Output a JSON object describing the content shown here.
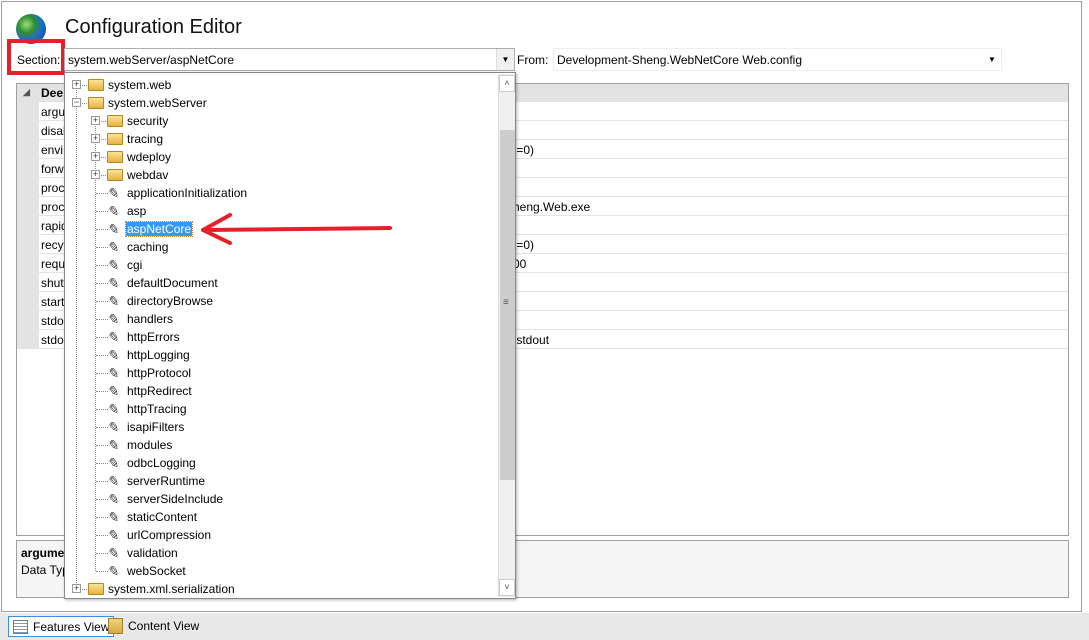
{
  "header": {
    "title": "Configuration Editor",
    "icon": "globe-icon"
  },
  "section": {
    "label": "Section:",
    "value": "system.webServer/aspNetCore"
  },
  "from": {
    "label": "From:",
    "value": "Development-Sheng.WebNetCore Web.config"
  },
  "grid": {
    "header": "Dee",
    "rows": [
      {
        "name": "argu",
        "value": ""
      },
      {
        "name": "disal",
        "value": ""
      },
      {
        "name": "envi",
        "value": "t=0)"
      },
      {
        "name": "forw",
        "value": ""
      },
      {
        "name": "proc",
        "value": ""
      },
      {
        "name": "proc",
        "value": "heng.Web.exe"
      },
      {
        "name": "rapid",
        "value": ""
      },
      {
        "name": "recy",
        "value": "t=0)"
      },
      {
        "name": "requ",
        "value": "00"
      },
      {
        "name": "shut",
        "value": ""
      },
      {
        "name": "start",
        "value": ""
      },
      {
        "name": "stdo",
        "value": ""
      },
      {
        "name": "stdo",
        "value": ".stdout"
      }
    ]
  },
  "description": {
    "name": "argume",
    "datatype": "Data Typ"
  },
  "tree": [
    {
      "label": "system.web",
      "level": 0,
      "type": "folder",
      "expander": "+"
    },
    {
      "label": "system.webServer",
      "level": 0,
      "type": "folder",
      "expander": "−"
    },
    {
      "label": "security",
      "level": 1,
      "type": "folder",
      "expander": "+"
    },
    {
      "label": "tracing",
      "level": 1,
      "type": "folder",
      "expander": "+"
    },
    {
      "label": "wdeploy",
      "level": 1,
      "type": "folder",
      "expander": "+"
    },
    {
      "label": "webdav",
      "level": 1,
      "type": "folder",
      "expander": "+"
    },
    {
      "label": "applicationInitialization",
      "level": 1,
      "type": "section"
    },
    {
      "label": "asp",
      "level": 1,
      "type": "section"
    },
    {
      "label": "aspNetCore",
      "level": 1,
      "type": "section",
      "selected": true
    },
    {
      "label": "caching",
      "level": 1,
      "type": "section"
    },
    {
      "label": "cgi",
      "level": 1,
      "type": "section"
    },
    {
      "label": "defaultDocument",
      "level": 1,
      "type": "section"
    },
    {
      "label": "directoryBrowse",
      "level": 1,
      "type": "section"
    },
    {
      "label": "handlers",
      "level": 1,
      "type": "section"
    },
    {
      "label": "httpErrors",
      "level": 1,
      "type": "section"
    },
    {
      "label": "httpLogging",
      "level": 1,
      "type": "section"
    },
    {
      "label": "httpProtocol",
      "level": 1,
      "type": "section"
    },
    {
      "label": "httpRedirect",
      "level": 1,
      "type": "section"
    },
    {
      "label": "httpTracing",
      "level": 1,
      "type": "section"
    },
    {
      "label": "isapiFilters",
      "level": 1,
      "type": "section"
    },
    {
      "label": "modules",
      "level": 1,
      "type": "section"
    },
    {
      "label": "odbcLogging",
      "level": 1,
      "type": "section"
    },
    {
      "label": "serverRuntime",
      "level": 1,
      "type": "section"
    },
    {
      "label": "serverSideInclude",
      "level": 1,
      "type": "section"
    },
    {
      "label": "staticContent",
      "level": 1,
      "type": "section"
    },
    {
      "label": "urlCompression",
      "level": 1,
      "type": "section"
    },
    {
      "label": "validation",
      "level": 1,
      "type": "section"
    },
    {
      "label": "webSocket",
      "level": 1,
      "type": "section"
    },
    {
      "label": "system.xml.serialization",
      "level": 0,
      "type": "folder",
      "expander": "+"
    }
  ],
  "annotation": {
    "color": "#e4202a",
    "selection_color": "#3399ff"
  },
  "bottom": {
    "features_view": "Features View",
    "content_view": "Content View"
  }
}
